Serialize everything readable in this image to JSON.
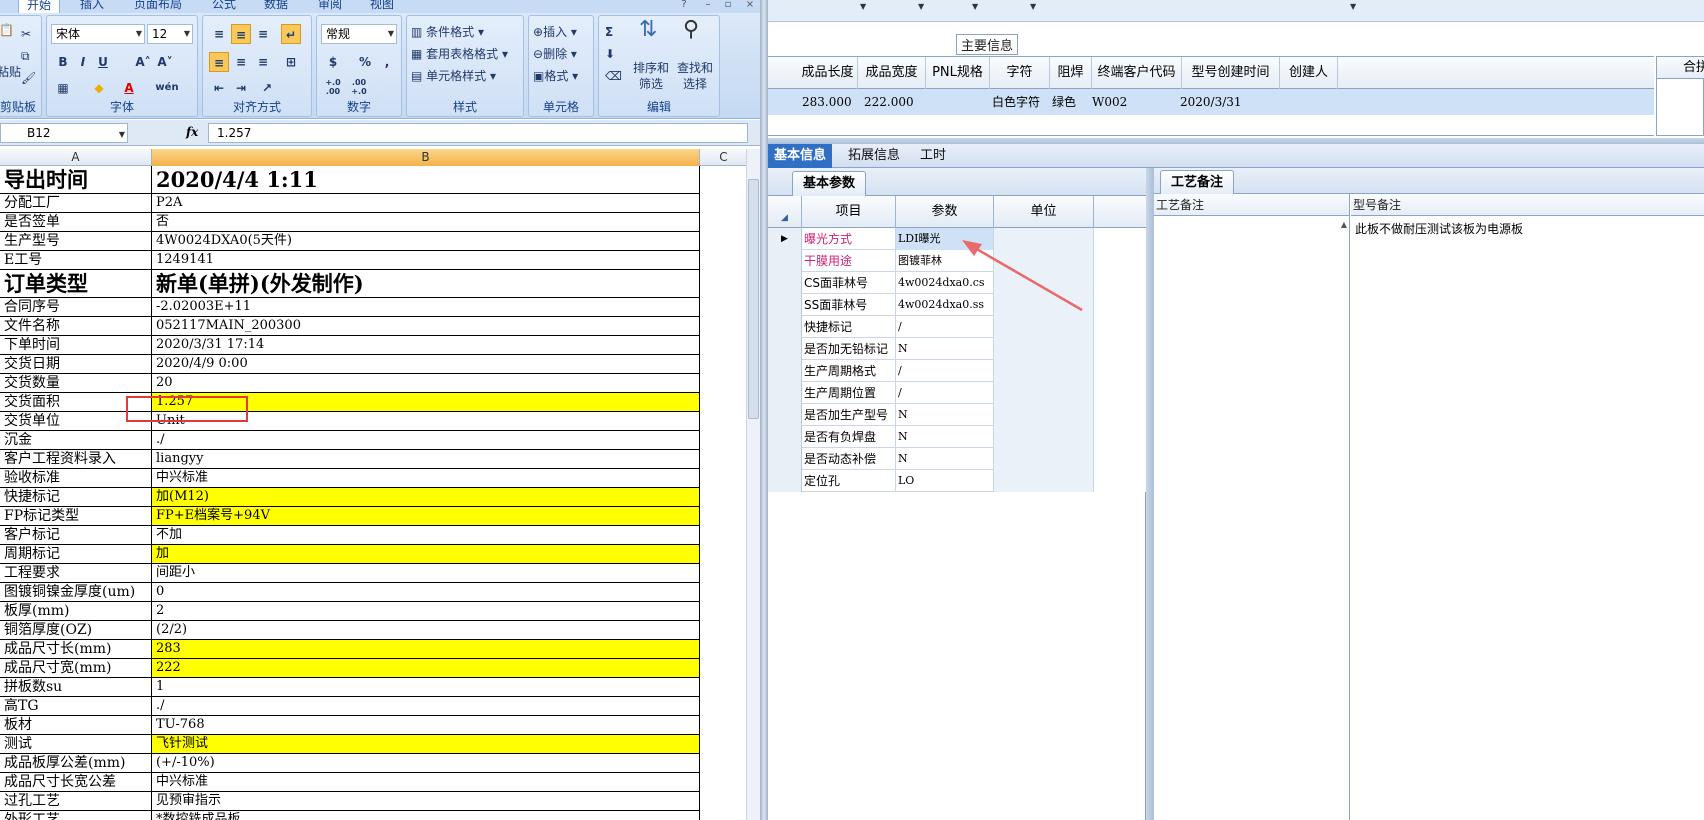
{
  "excel": {
    "ribbon_tabs": [
      "开始",
      "插入",
      "页面布局",
      "公式",
      "数据",
      "审阅",
      "视图"
    ],
    "clipboard": {
      "paste_label": "粘贴",
      "group_label": "剪贴板"
    },
    "font": {
      "name": "宋体",
      "size": "12",
      "group_label": "字体",
      "bold": "B",
      "italic": "I",
      "underline": "U",
      "grow": "A˄",
      "shrink": "A˅",
      "phonetic": "wén"
    },
    "alignment": {
      "group_label": "对齐方式"
    },
    "number": {
      "format": "常规",
      "group_label": "数字",
      "currency": "$",
      "percent": "%",
      "comma": ",",
      "inc_decimal": "+.0\n.00",
      "dec_decimal": ".00\n+.0"
    },
    "styles": {
      "conditional": "条件格式",
      "table_format": "套用表格格式",
      "cell_styles": "单元格样式",
      "group_label": "样式"
    },
    "cells": {
      "insert": "插入",
      "delete": "删除",
      "format": "格式",
      "group_label": "单元格"
    },
    "editing": {
      "sigma": "Σ",
      "sort_filter": "排序和\n筛选",
      "find_select": "查找和\n选择",
      "group_label": "编辑"
    },
    "name_box": "B12",
    "fx": "fx",
    "formula_value": "1.257",
    "columns": [
      "A",
      "B",
      "C"
    ],
    "rows": [
      {
        "a": "导出时间",
        "b": "2020/4/4  1:11",
        "big": true
      },
      {
        "a": "分配工厂",
        "b": "P2A"
      },
      {
        "a": "是否签单",
        "b": "否"
      },
      {
        "a": "生产型号",
        "b": "4W0024DXA0(5天件)"
      },
      {
        "a": "E工号",
        "b": "1249141"
      },
      {
        "a": "订单类型",
        "b": "新单(单拼)(外发制作)",
        "big": true
      },
      {
        "a": "合同序号",
        "b": "-2.02003E+11"
      },
      {
        "a": "文件名称",
        "b": "052117MAIN_200300"
      },
      {
        "a": "下单时间",
        "b": "2020/3/31 17:14"
      },
      {
        "a": "交货日期",
        "b": "2020/4/9 0:00"
      },
      {
        "a": "交货数量",
        "b": "20"
      },
      {
        "a": "交货面积",
        "b": "1.257",
        "yellow": true
      },
      {
        "a": "交货单位",
        "b": "Unit"
      },
      {
        "a": "沉金",
        "b": "./"
      },
      {
        "a": "客户工程资料录入",
        "b": "liangyy"
      },
      {
        "a": "验收标准",
        "b": "中兴标准"
      },
      {
        "a": "快捷标记",
        "b": "加(M12)",
        "yellow": true
      },
      {
        "a": "FP标记类型",
        "b": "FP+E档案号+94V",
        "yellow": true
      },
      {
        "a": "客户标记",
        "b": "不加"
      },
      {
        "a": "周期标记",
        "b": "加",
        "yellow": true
      },
      {
        "a": "工程要求",
        "b": "间距小"
      },
      {
        "a": "图镀铜镍金厚度(um)",
        "b": "0"
      },
      {
        "a": "板厚(mm)",
        "b": "2"
      },
      {
        "a": "铜箔厚度(OZ)",
        "b": "(2/2)"
      },
      {
        "a": "成品尺寸长(mm)",
        "b": "283",
        "yellow": true
      },
      {
        "a": "成品尺寸宽(mm)",
        "b": "222",
        "yellow": true
      },
      {
        "a": "拼板数su",
        "b": "1"
      },
      {
        "a": "高TG",
        "b": "./"
      },
      {
        "a": "板材",
        "b": "TU-768"
      },
      {
        "a": "测试",
        "b": "飞针测试",
        "yellow": true
      },
      {
        "a": "成品板厚公差(mm)",
        "b": "(+/-10%)"
      },
      {
        "a": "成品尺寸长宽公差",
        "b": "中兴标准"
      },
      {
        "a": "过孔工艺",
        "b": "见预审指示"
      },
      {
        "a": "外形工艺",
        "b": "*数控铣成品板"
      }
    ]
  },
  "erp": {
    "main_info_label": "主要信息",
    "main_columns": [
      "成品长度",
      "成品宽度",
      "PNL规格",
      "字符",
      "阻焊",
      "终端客户代码",
      "型号创建时间",
      "创建人"
    ],
    "main_row": {
      "length": "283.000",
      "width": "222.000",
      "pnl": "",
      "char": "白色字符",
      "mask": "绿色",
      "customer": "W002",
      "created": "2020/3/31",
      "creator": ""
    },
    "side_header": "合拼",
    "tabs": [
      "基本信息",
      "拓展信息",
      "工时"
    ],
    "basic_params_tab": "基本参数",
    "param_columns": [
      "项目",
      "参数",
      "单位"
    ],
    "params": [
      {
        "item": "曝光方式",
        "value": "LDI曝光",
        "pink": true,
        "current": true
      },
      {
        "item": "干膜用途",
        "value": "图镀菲林",
        "pink": true
      },
      {
        "item": "CS面菲林号",
        "value": "4w0024dxa0.cs"
      },
      {
        "item": "SS面菲林号",
        "value": "4w0024dxa0.ss"
      },
      {
        "item": "快捷标记",
        "value": "/"
      },
      {
        "item": "是否加无铅标记",
        "value": "N"
      },
      {
        "item": "生产周期格式",
        "value": "/"
      },
      {
        "item": "生产周期位置",
        "value": "/"
      },
      {
        "item": "是否加生产型号",
        "value": "N"
      },
      {
        "item": "是否有负焊盘",
        "value": "N"
      },
      {
        "item": "是否动态补偿",
        "value": "N"
      },
      {
        "item": "定位孔",
        "value": "LO"
      }
    ],
    "process_tab": "工艺备注",
    "process_col": "工艺备注",
    "model_col": "型号备注",
    "model_note": "此板不做耐压测试该板为电源板"
  },
  "colors": {
    "highlight_yellow": "#ffff00",
    "annotation_red": "#e23a3a",
    "arrow_red": "#e86a6a",
    "selection_blue": "#cfe1f7"
  }
}
